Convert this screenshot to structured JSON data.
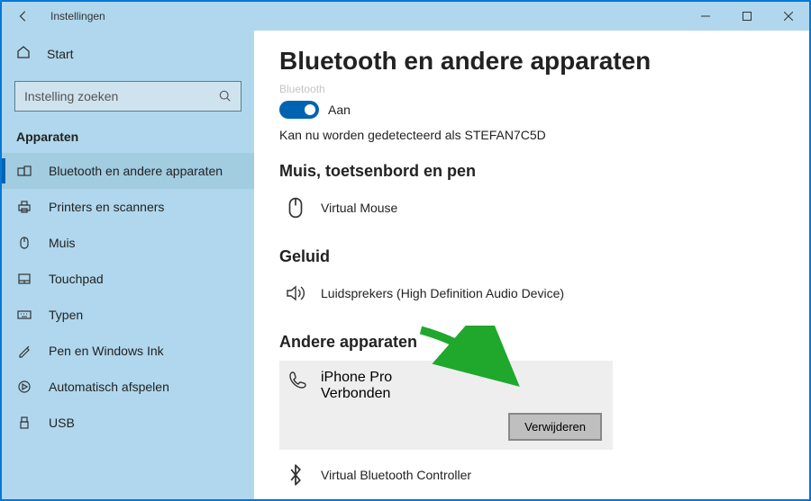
{
  "titlebar": {
    "title": "Instellingen"
  },
  "sidebar": {
    "home": "Start",
    "search_placeholder": "Instelling zoeken",
    "section": "Apparaten",
    "items": [
      {
        "label": "Bluetooth en andere apparaten"
      },
      {
        "label": "Printers en scanners"
      },
      {
        "label": "Muis"
      },
      {
        "label": "Touchpad"
      },
      {
        "label": "Typen"
      },
      {
        "label": "Pen en Windows Ink"
      },
      {
        "label": "Automatisch afspelen"
      },
      {
        "label": "USB"
      }
    ]
  },
  "main": {
    "heading": "Bluetooth en andere apparaten",
    "toggle": {
      "label_cut": "Bluetooth",
      "state": "Aan"
    },
    "discover": "Kan nu worden gedetecteerd als STEFAN7C5D",
    "group1": {
      "title": "Muis, toetsenbord en pen",
      "device": "Virtual Mouse"
    },
    "group2": {
      "title": "Geluid",
      "device": "Luidsprekers (High Definition Audio Device)"
    },
    "group3": {
      "title": "Andere apparaten",
      "device": "iPhone Pro",
      "status": "Verbonden",
      "remove": "Verwijderen",
      "device2": "Virtual Bluetooth Controller"
    }
  }
}
